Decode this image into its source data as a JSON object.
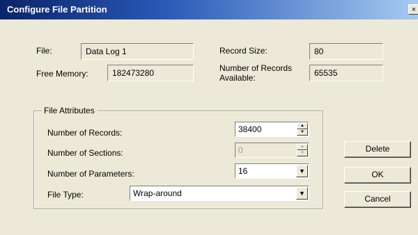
{
  "window": {
    "title": "Configure File Partition",
    "close_label": "×"
  },
  "file": {
    "label": "File:",
    "value": "Data Log 1"
  },
  "free_memory": {
    "label": "Free Memory:",
    "value": "182473280"
  },
  "record_size": {
    "label": "Record Size:",
    "value": "80"
  },
  "records_available": {
    "label": "Number of Records Available:",
    "value": "65535"
  },
  "attributes": {
    "legend": "File Attributes",
    "num_records": {
      "label": "Number of Records:",
      "value": "38400"
    },
    "num_sections": {
      "label": "Number of Sections:",
      "value": "0",
      "disabled": true
    },
    "num_parameters": {
      "label": "Number of Parameters:",
      "value": "16"
    },
    "file_type": {
      "label": "File Type:",
      "value": "Wrap-around"
    }
  },
  "buttons": {
    "delete": "Delete",
    "ok": "OK",
    "cancel": "Cancel"
  },
  "icons": {
    "spin_up": "▲",
    "spin_down": "▼",
    "dropdown": "▼"
  }
}
